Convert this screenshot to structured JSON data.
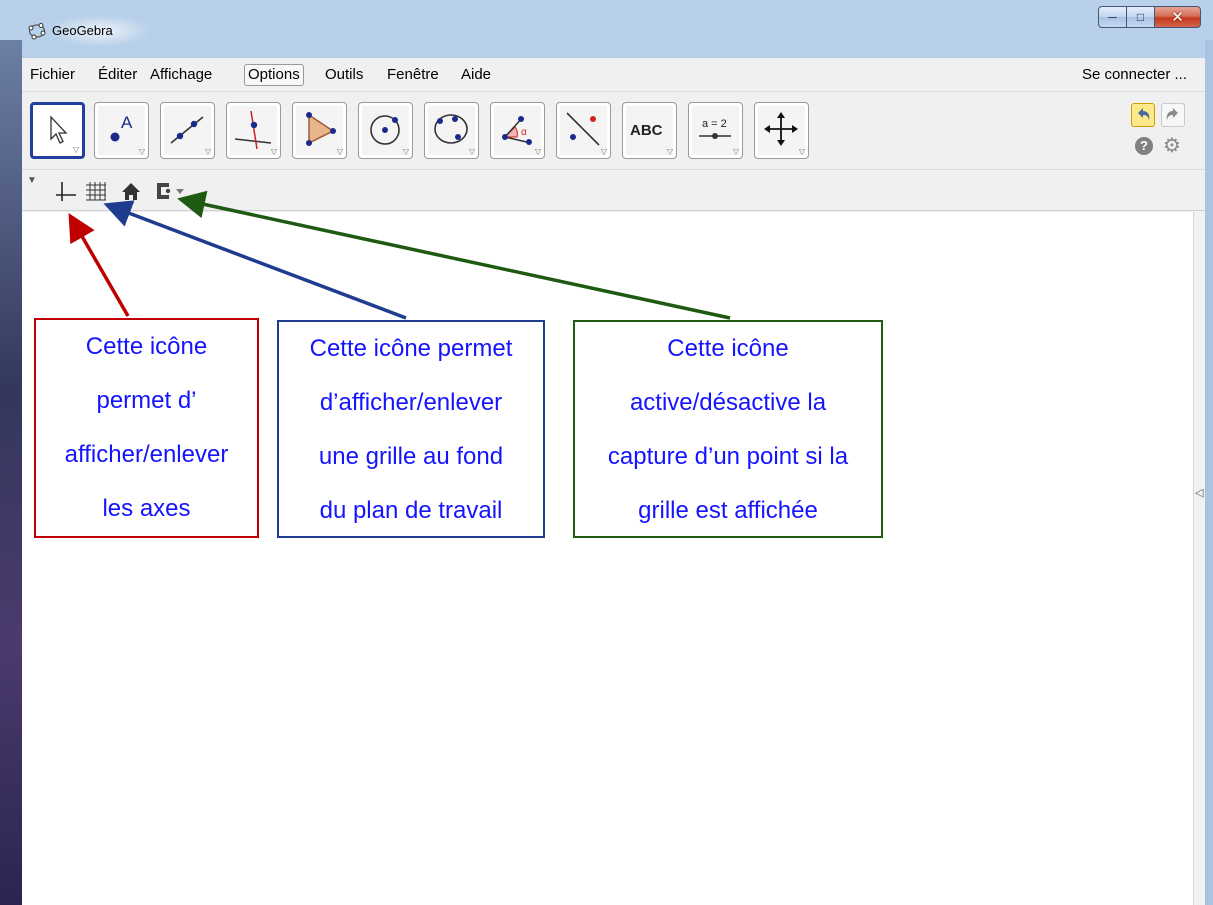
{
  "window": {
    "title": "GeoGebra",
    "icon": "geogebra-logo-icon",
    "caption_buttons": [
      "minimize-icon",
      "maximize-icon",
      "close-icon"
    ]
  },
  "menubar": {
    "items": [
      "Fichier",
      "Éditer",
      "Affichage",
      "Options",
      "Outils",
      "Fenêtre",
      "Aide"
    ],
    "active": "Options",
    "connect_label": "Se connecter ..."
  },
  "toolbar": {
    "tools": [
      {
        "name": "move-tool",
        "icon": "arrow-pointer-icon",
        "selected": true
      },
      {
        "name": "point-tool",
        "icon": "point-a-icon",
        "label": "A"
      },
      {
        "name": "line-tool",
        "icon": "line-through-two-points-icon"
      },
      {
        "name": "perpendicular-line-tool",
        "icon": "perpendicular-line-icon"
      },
      {
        "name": "polygon-tool",
        "icon": "polygon-icon"
      },
      {
        "name": "circle-center-point-tool",
        "icon": "circle-center-point-icon"
      },
      {
        "name": "circle-three-points-tool",
        "icon": "ellipse-three-points-icon"
      },
      {
        "name": "angle-tool",
        "icon": "angle-alpha-icon",
        "label": "α"
      },
      {
        "name": "reflect-tool",
        "icon": "reflect-point-icon"
      },
      {
        "name": "text-tool",
        "icon": "text-icon",
        "label": "ABC"
      },
      {
        "name": "slider-tool",
        "icon": "slider-icon",
        "label": "a = 2"
      },
      {
        "name": "move-graphics-view-tool",
        "icon": "move-arrows-icon"
      }
    ],
    "right": [
      "undo-icon",
      "redo-icon",
      "help-icon",
      "gear-icon"
    ]
  },
  "stylebar": {
    "icons": [
      "axes-icon",
      "grid-icon",
      "home-icon",
      "point-capturing-icon"
    ]
  },
  "annotations": {
    "red": {
      "lines": [
        "Cette icône",
        "permet d’",
        "afficher/enlever",
        "les axes"
      ],
      "color": "#c00000"
    },
    "blue": {
      "lines": [
        "Cette icône permet",
        "d’afficher/enlever",
        "une grille au fond",
        "du plan de travail"
      ],
      "color": "#1f3c8f"
    },
    "green": {
      "lines": [
        "Cette icône",
        "active/désactive la",
        "capture d’un point si la",
        "grille est affichée"
      ],
      "color": "#1f5a12"
    }
  },
  "colors": {
    "annotation_text": "#1414ff",
    "selected_tool_border": "#2140a0"
  }
}
